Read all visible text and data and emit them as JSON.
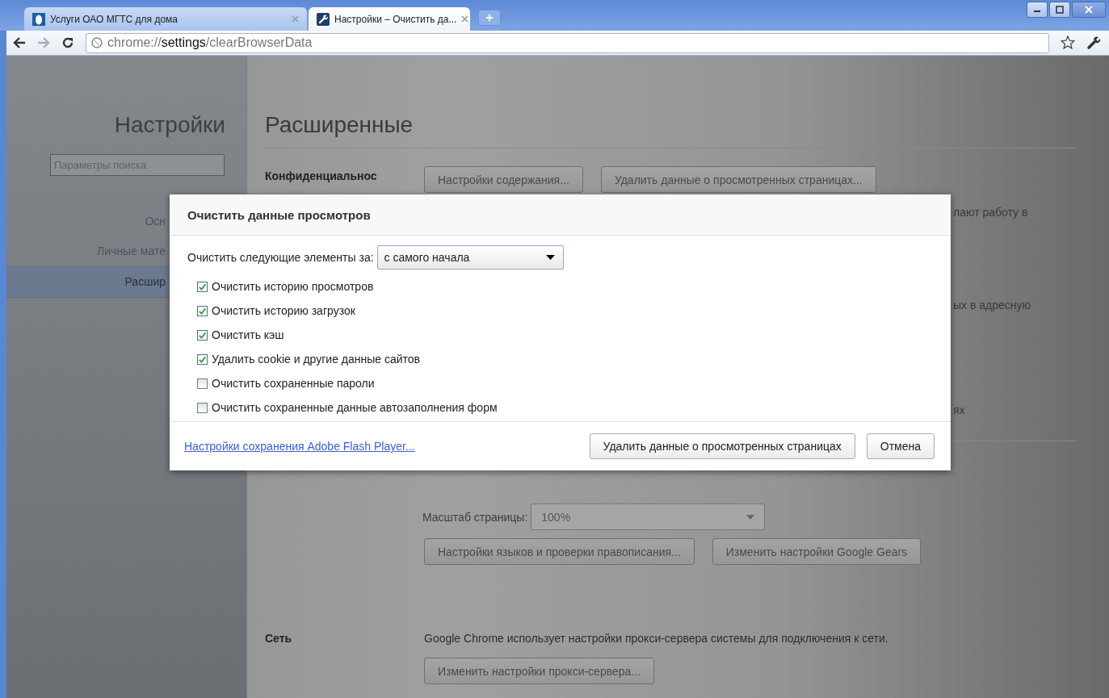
{
  "tabs": [
    {
      "title": "Услуги ОАО МГТС для дома",
      "selected": false,
      "kind": "site"
    },
    {
      "title": "Настройки – Очистить да...",
      "selected": true,
      "kind": "settings"
    }
  ],
  "address_bar": {
    "url": "chrome://**settings**/clearBrowserData"
  },
  "sidebar": {
    "title": "Настройки",
    "search": {
      "placeholder": "Параметры поиска"
    },
    "items": [
      {
        "label": "Осн",
        "selected": false
      },
      {
        "label": "Личные мате",
        "selected": false
      },
      {
        "label": "Расшир",
        "selected": true
      }
    ]
  },
  "page": {
    "title": "Расширенные",
    "privacy": {
      "label": "Конфиденциальнос",
      "buttons": [
        "Настройки содержания...",
        "Удалить данные о просмотренных страницах..."
      ],
      "text_fragments": [
        "лают работу в",
        "ых в адресную",
        "ях"
      ]
    },
    "zoom": {
      "label": "Масштаб страницы:",
      "value": "100%"
    },
    "content_buttons": [
      "Настройки языков и проверки правописания...",
      "Изменить настройки Google Gears"
    ],
    "network": {
      "label": "Сеть",
      "text": "Google Chrome использует настройки прокси-сервера системы для подключения к сети.",
      "button": "Изменить настройки прокси-сервера..."
    }
  },
  "dialog": {
    "title": "Очистить данные просмотров",
    "period_label": "Очистить следующие элементы за:",
    "period_value": "с самого начала",
    "options": [
      {
        "label": "Очистить историю просмотров",
        "checked": true
      },
      {
        "label": "Очистить историю загрузок",
        "checked": true
      },
      {
        "label": "Очистить кэш",
        "checked": true
      },
      {
        "label": "Удалить cookie и другие данные сайтов",
        "checked": true
      },
      {
        "label": "Очистить сохраненные пароли",
        "checked": false
      },
      {
        "label": "Очистить сохраненные данные автозаполнения форм",
        "checked": false
      }
    ],
    "link": "Настройки сохранения Adobe Flash Player...",
    "buttons": [
      "Удалить данные о просмотренных страницах",
      "Отмена"
    ]
  }
}
